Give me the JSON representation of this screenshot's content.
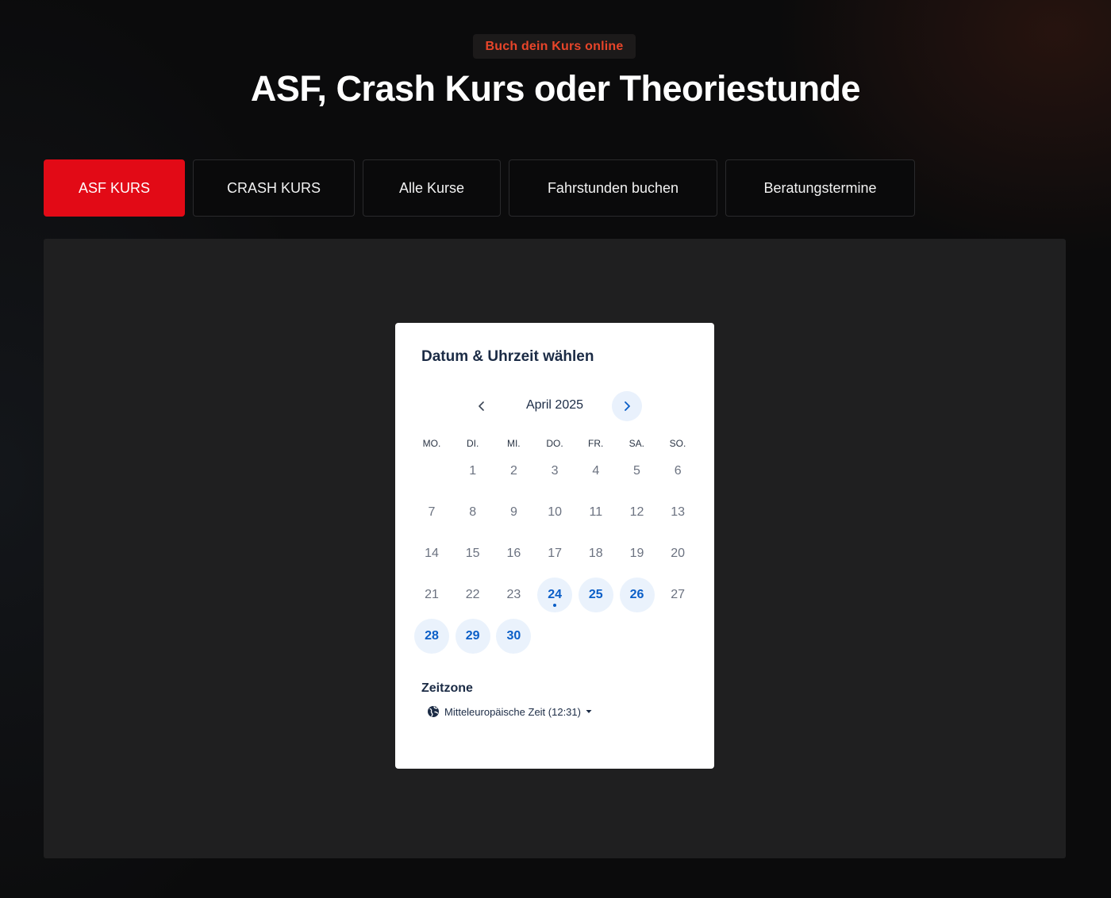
{
  "header": {
    "eyebrow": "Buch dein Kurs online",
    "title": "ASF, Crash Kurs oder Theoriestunde"
  },
  "tabs": [
    {
      "label": "ASF KURS",
      "active": true
    },
    {
      "label": "CRASH KURS",
      "active": false
    },
    {
      "label": "Alle Kurse",
      "active": false
    },
    {
      "label": "Fahrstunden buchen",
      "active": false
    },
    {
      "label": "Beratungstermine",
      "active": false
    }
  ],
  "scheduler": {
    "title": "Datum & Uhrzeit wählen",
    "month_label": "April 2025",
    "prev_icon": "chevron-left-icon",
    "next_icon": "chevron-right-icon",
    "weekdays": [
      "MO.",
      "DI.",
      "MI.",
      "DO.",
      "FR.",
      "SA.",
      "SO."
    ],
    "days": [
      {
        "label": "1",
        "available": false
      },
      {
        "label": "2",
        "available": false
      },
      {
        "label": "3",
        "available": false
      },
      {
        "label": "4",
        "available": false
      },
      {
        "label": "5",
        "available": false
      },
      {
        "label": "6",
        "available": false
      },
      {
        "label": "7",
        "available": false
      },
      {
        "label": "8",
        "available": false
      },
      {
        "label": "9",
        "available": false
      },
      {
        "label": "10",
        "available": false
      },
      {
        "label": "11",
        "available": false
      },
      {
        "label": "12",
        "available": false
      },
      {
        "label": "13",
        "available": false
      },
      {
        "label": "14",
        "available": false
      },
      {
        "label": "15",
        "available": false
      },
      {
        "label": "16",
        "available": false
      },
      {
        "label": "17",
        "available": false
      },
      {
        "label": "18",
        "available": false
      },
      {
        "label": "19",
        "available": false
      },
      {
        "label": "20",
        "available": false
      },
      {
        "label": "21",
        "available": false
      },
      {
        "label": "22",
        "available": false
      },
      {
        "label": "23",
        "available": false
      },
      {
        "label": "24",
        "available": true,
        "today": true
      },
      {
        "label": "25",
        "available": true
      },
      {
        "label": "26",
        "available": true
      },
      {
        "label": "27",
        "available": false
      },
      {
        "label": "28",
        "available": true
      },
      {
        "label": "29",
        "available": true
      },
      {
        "label": "30",
        "available": true
      }
    ],
    "timezone_label": "Zeitzone",
    "timezone_value": "Mitteleuropäische Zeit (12:31)",
    "timezone_icon": "globe-icon"
  },
  "colors": {
    "accent_red": "#e20a16",
    "eyebrow_text": "#e8452a",
    "available_day_bg": "#eaf2fc",
    "available_day_text": "#0a5ec7",
    "heading_navy": "#1b2b45"
  }
}
